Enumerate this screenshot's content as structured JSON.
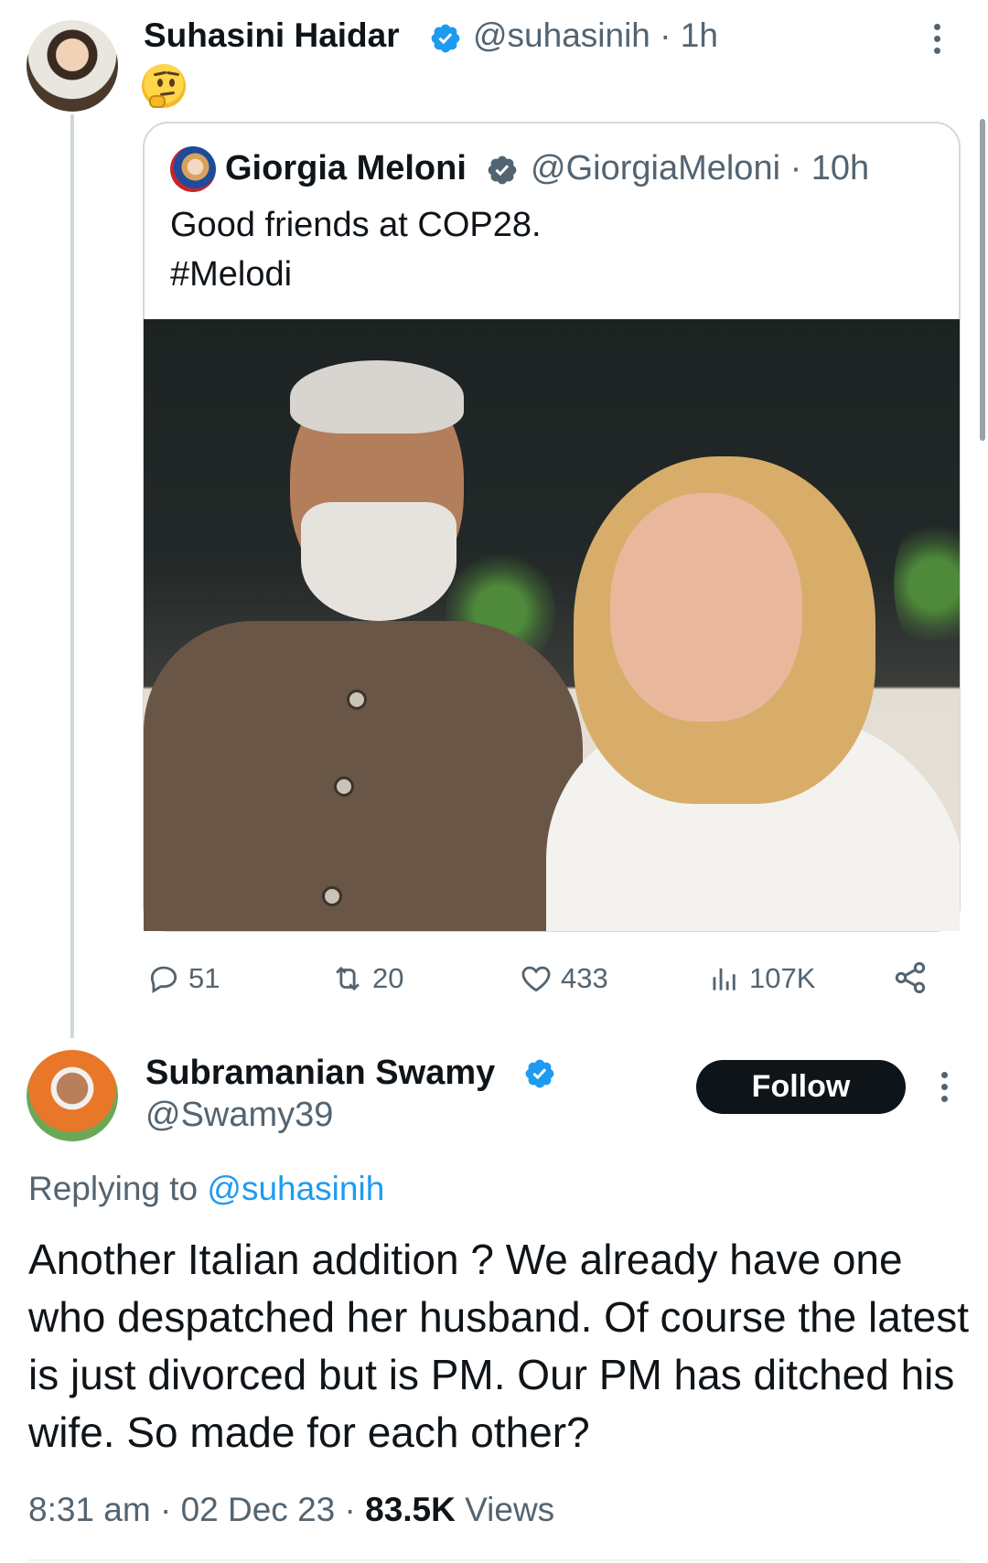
{
  "tweet": {
    "author_name": "Suhasini Haidar",
    "author_handle": "@suhasinih · 1h",
    "emoji": "thinking-face",
    "quote": {
      "author_name": "Giorgia Meloni",
      "author_handle": "@GiorgiaMeloni · 10h",
      "text_line_1": "Good friends at COP28.",
      "text_line_2": "#Melodi"
    },
    "actions": {
      "replies": "51",
      "retweets": "20",
      "likes": "433",
      "views": "107K"
    }
  },
  "reply": {
    "author_name": "Subramanian Swamy",
    "author_handle": "@Swamy39",
    "follow_label": "Follow",
    "replying_prefix": "Replying to ",
    "replying_handle": "@suhasinih",
    "body": "Another Italian addition ? We already have one who despatched her husband. Of course the latest is just divorced but is PM. Our PM has ditched his wife. So made for each other?",
    "time": "8:31 am · 02 Dec 23 · ",
    "views_count": "83.5K",
    "views_label": " Views"
  },
  "colors": {
    "verified": "#1d9bf0",
    "text_primary": "#0f1419",
    "text_secondary": "#536471",
    "mention": "#1d9bf0"
  }
}
